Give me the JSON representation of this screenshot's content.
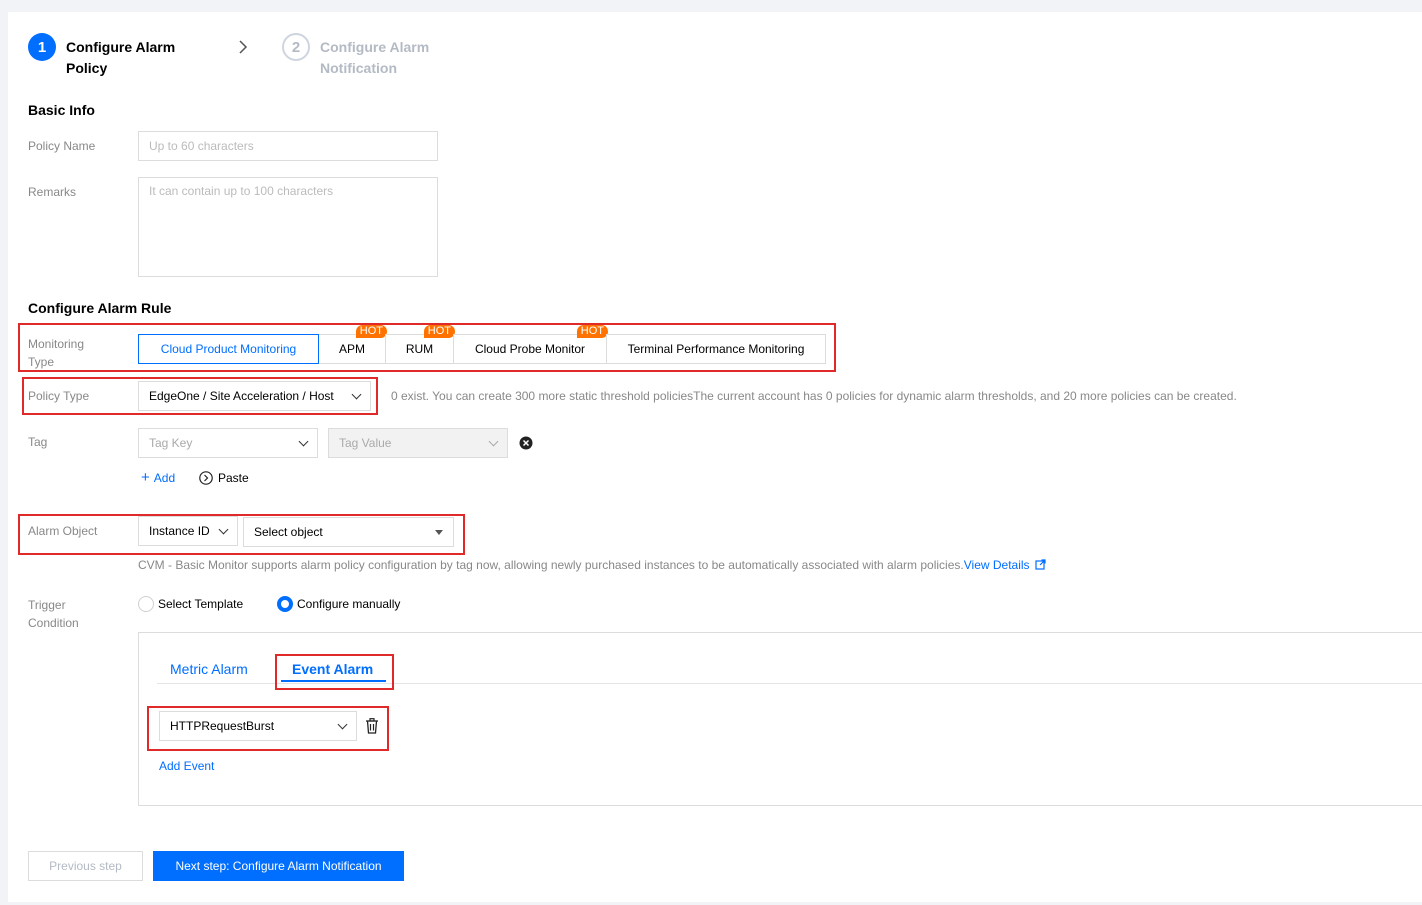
{
  "steps": [
    {
      "number": "1",
      "line1": "Configure Alarm",
      "line2": "Policy"
    },
    {
      "number": "2",
      "line1": "Configure Alarm",
      "line2": "Notification"
    }
  ],
  "basic_info": {
    "title": "Basic Info",
    "policy_name_label": "Policy Name",
    "policy_name_placeholder": "Up to 60 characters",
    "remarks_label": "Remarks",
    "remarks_placeholder": "It can contain up to 100 characters"
  },
  "alarm_rule": {
    "title": "Configure Alarm Rule",
    "monitoring_type_label_1": "Monitoring",
    "monitoring_type_label_2": "Type",
    "monitoring_types": [
      {
        "label": "Cloud Product Monitoring",
        "selected": true,
        "hot": ""
      },
      {
        "label": "APM",
        "selected": false,
        "hot": "HOT"
      },
      {
        "label": "RUM",
        "selected": false,
        "hot": "HOT"
      },
      {
        "label": "Cloud Probe Monitor",
        "selected": false,
        "hot": "HOT"
      },
      {
        "label": "Terminal Performance Monitoring",
        "selected": false,
        "hot": ""
      }
    ],
    "policy_type_label": "Policy Type",
    "policy_type_value": "EdgeOne / Site Acceleration / Host",
    "policy_type_hint": "0 exist. You can create 300 more static threshold policiesThe current account has 0 policies for dynamic alarm thresholds, and 20 more policies can be created.",
    "tag_label": "Tag",
    "tag_key_placeholder": "Tag Key",
    "tag_value_placeholder": "Tag Value",
    "add_label": "Add",
    "paste_label": "Paste",
    "alarm_object_label": "Alarm Object",
    "alarm_object_type": "Instance ID",
    "alarm_object_placeholder": "Select object",
    "alarm_object_hint": "CVM - Basic Monitor supports alarm policy configuration by tag now, allowing newly purchased instances to be automatically associated with alarm policies.",
    "view_details": "View Details",
    "trigger_label_1": "Trigger",
    "trigger_label_2": "Condition",
    "trigger_options": [
      {
        "label": "Select Template",
        "checked": false
      },
      {
        "label": "Configure manually",
        "checked": true
      }
    ],
    "tabs": [
      {
        "label": "Metric Alarm",
        "active": false
      },
      {
        "label": "Event Alarm",
        "active": true
      }
    ],
    "event_value": "HTTPRequestBurst",
    "add_event": "Add Event"
  },
  "footer": {
    "prev_label": "Previous step",
    "next_label": "Next step: Configure Alarm Notification"
  },
  "colors": {
    "primary": "#006eff",
    "hot_badge": "#ff7200",
    "highlight_box": "#e02a2a"
  }
}
